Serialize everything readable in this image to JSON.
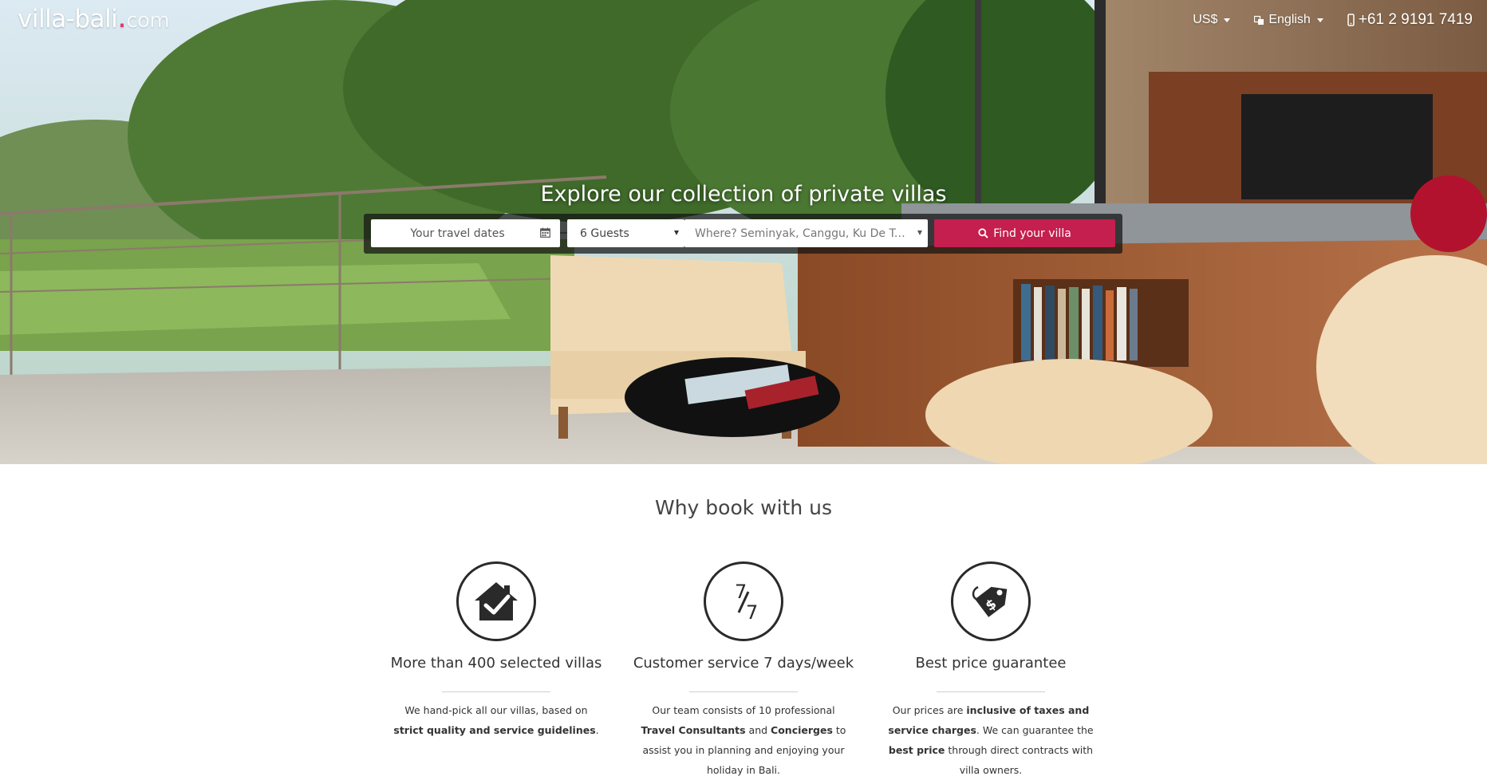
{
  "header": {
    "logo_main": "villa-bali",
    "logo_dot": ".",
    "logo_tld": "com",
    "currency": "US$",
    "language": "English",
    "phone": "+61 2 9191 7419"
  },
  "hero": {
    "title": "Explore our collection of private villas",
    "dates_placeholder": "Your travel dates",
    "guests_value": "6 Guests",
    "where_placeholder": "Where? Seminyak, Canggu, Ku De Ta...",
    "find_button": "Find your villa"
  },
  "why": {
    "title": "Why book with us",
    "features": [
      {
        "icon": "house-check-icon",
        "title": "More than 400 selected villas",
        "t1": "We hand-pick all our villas, based on ",
        "b1": "strict quality and service guidelines",
        "t2": "."
      },
      {
        "icon": "seven-days-icon",
        "icon_text_top": "7",
        "icon_text_bottom": "7",
        "title": "Customer service 7 days/week",
        "t1": "Our team consists of 10 professional ",
        "b1": "Travel Consultants",
        "t2": " and ",
        "b2": "Concierges",
        "t3": " to assist you in planning and enjoying your holiday in Bali."
      },
      {
        "icon": "price-tag-icon",
        "title": "Best price guarantee",
        "t1": "Our prices are ",
        "b1": "inclusive of taxes and service charges",
        "t2": ". We can guarantee the ",
        "b2": "best price",
        "t3": " through direct contracts with villa owners."
      }
    ]
  },
  "colors": {
    "accent": "#c41f4e",
    "logo_dot": "#e8316a"
  }
}
